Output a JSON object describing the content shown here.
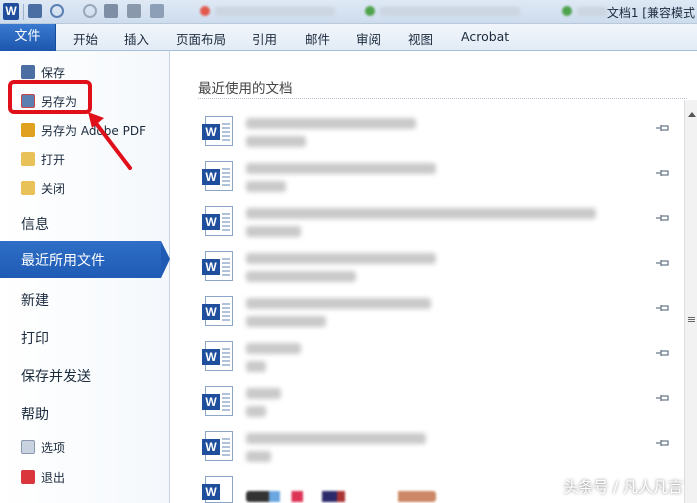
{
  "window": {
    "logo_letter": "W",
    "title": "文档1 [兼容模式"
  },
  "ribbon": {
    "file_tab": "文件",
    "tabs": [
      "开始",
      "插入",
      "页面布局",
      "引用",
      "邮件",
      "审阅",
      "视图",
      "Acrobat"
    ]
  },
  "backstage": {
    "commands": [
      {
        "label": "保存",
        "icon": "save-icon"
      },
      {
        "label": "另存为",
        "icon": "save-as-icon"
      },
      {
        "label": "另存为 Adobe PDF",
        "icon": "pdf-icon"
      },
      {
        "label": "打开",
        "icon": "open-folder-icon"
      },
      {
        "label": "关闭",
        "icon": "close-folder-icon"
      }
    ],
    "nav": {
      "info": "信息",
      "recent": "最近所用文件",
      "new": "新建",
      "print": "打印",
      "save_send": "保存并发送",
      "help": "帮助",
      "options": "选项",
      "exit": "退出"
    }
  },
  "recent": {
    "heading": "最近使用的文档",
    "doc_icon_letter": "W"
  },
  "watermark": "头条号 / 凡人凡言",
  "colors": {
    "accent": "#1f5bb5",
    "annotation": "#e0101a"
  }
}
